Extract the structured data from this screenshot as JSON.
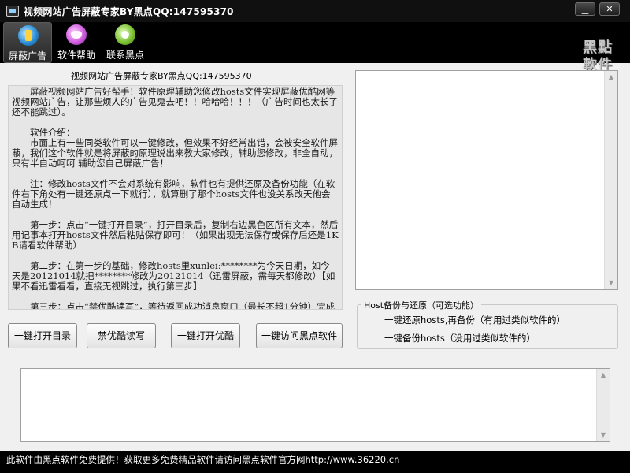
{
  "window": {
    "title": "视频网站广告屏蔽专家BY黑点QQ:147595370",
    "min_glyph": "▁",
    "close_glyph": "✕"
  },
  "toolbar": {
    "items": [
      {
        "label": "屏蔽广告",
        "icon": "shield-icon"
      },
      {
        "label": "软件帮助",
        "icon": "butterfly-icon"
      },
      {
        "label": "联系黑点",
        "icon": "contact-icon"
      }
    ]
  },
  "logo": {
    "line1": "黑點",
    "line2": "軟件"
  },
  "main": {
    "title": "视频网站广告屏蔽专家BY黑点QQ:147595370",
    "intro": [
      "屏蔽视频网站广告好帮手！软件原理辅助您修改hosts文件实现屏蔽优酷网等视频网站广告，让那些烦人的广告见鬼去吧！！哈哈哈！！！（广告时间也太长了还不能跳过）。",
      "软件介绍：",
      "市面上有一些同类软件可以一键修改，但效果不好经常出错，会被安全软件屏蔽，我们这个软件就是将屏蔽的原理说出来教大家修改，辅助您修改，非全自动，只有半自动呵呵 辅助您自己屏蔽广告！",
      "注：修改hosts文件不会对系统有影响，软件也有提供还原及备份功能（在软件右下角处有一键还原点一下就行），就算删了那个hosts文件也没关系改天他会自动生成！",
      "第一步：点击“一键打开目录”，打开目录后，复制右边黑色区所有文本，然后用记事本打开hosts文件然后粘贴保存即可！（如果出现无法保存或保存后还是1KB请看软件帮助）",
      "第二步：在第一步的基础，修改hosts里xunlei:********为今天日期，如今天是20121014就把********修改为20121014（迅雷屏蔽，需每天都修改）【如果不看迅雷看看，直接无视跳过，执行第三步】",
      "第三步：点击“禁优酷读写”，等待返回成功消息窗口（最长不超1分钟）完成后点击一键打开优酷，测试看看广告是不是没啦哈哈哈！！"
    ],
    "buttons": {
      "open_dir": "一键打开目录",
      "youku_rw": "禁优酷读写",
      "open_youku": "一键打开优酷",
      "visit_site": "一键访问黑点软件"
    },
    "backup_group": {
      "legend": "Host备份与还原（可选功能）",
      "restore": "一键还原hosts,再备份（有用过类似软件的）",
      "backup": "一键备份hosts（没用过类似软件的）"
    }
  },
  "status": {
    "text": "此软件由黑点软件免费提供！获取更多免费精品软件请访问黑点软件官方网http://www.36220.cn"
  }
}
